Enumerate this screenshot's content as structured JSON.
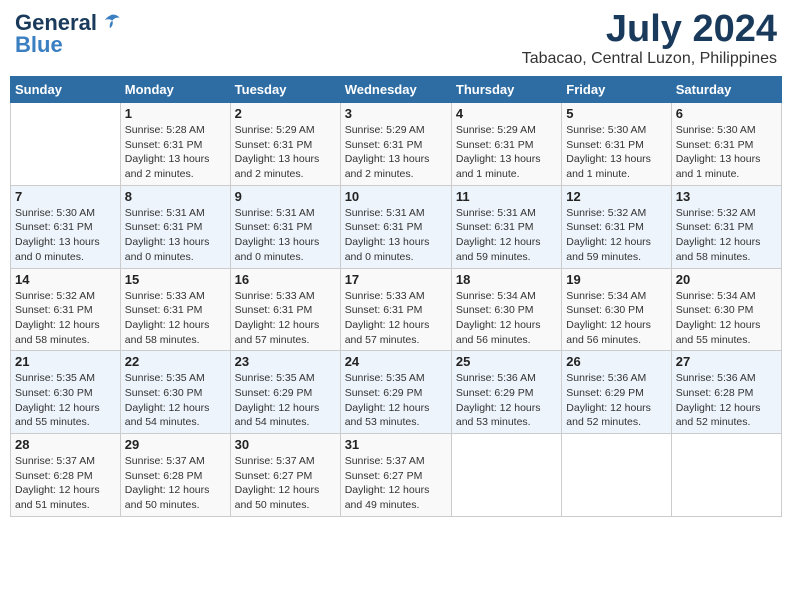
{
  "header": {
    "logo_general": "General",
    "logo_blue": "Blue",
    "main_title": "July 2024",
    "subtitle": "Tabacao, Central Luzon, Philippines"
  },
  "calendar": {
    "days_of_week": [
      "Sunday",
      "Monday",
      "Tuesday",
      "Wednesday",
      "Thursday",
      "Friday",
      "Saturday"
    ],
    "weeks": [
      [
        {
          "day": "",
          "info": ""
        },
        {
          "day": "1",
          "info": "Sunrise: 5:28 AM\nSunset: 6:31 PM\nDaylight: 13 hours\nand 2 minutes."
        },
        {
          "day": "2",
          "info": "Sunrise: 5:29 AM\nSunset: 6:31 PM\nDaylight: 13 hours\nand 2 minutes."
        },
        {
          "day": "3",
          "info": "Sunrise: 5:29 AM\nSunset: 6:31 PM\nDaylight: 13 hours\nand 2 minutes."
        },
        {
          "day": "4",
          "info": "Sunrise: 5:29 AM\nSunset: 6:31 PM\nDaylight: 13 hours\nand 1 minute."
        },
        {
          "day": "5",
          "info": "Sunrise: 5:30 AM\nSunset: 6:31 PM\nDaylight: 13 hours\nand 1 minute."
        },
        {
          "day": "6",
          "info": "Sunrise: 5:30 AM\nSunset: 6:31 PM\nDaylight: 13 hours\nand 1 minute."
        }
      ],
      [
        {
          "day": "7",
          "info": "Sunrise: 5:30 AM\nSunset: 6:31 PM\nDaylight: 13 hours\nand 0 minutes."
        },
        {
          "day": "8",
          "info": "Sunrise: 5:31 AM\nSunset: 6:31 PM\nDaylight: 13 hours\nand 0 minutes."
        },
        {
          "day": "9",
          "info": "Sunrise: 5:31 AM\nSunset: 6:31 PM\nDaylight: 13 hours\nand 0 minutes."
        },
        {
          "day": "10",
          "info": "Sunrise: 5:31 AM\nSunset: 6:31 PM\nDaylight: 13 hours\nand 0 minutes."
        },
        {
          "day": "11",
          "info": "Sunrise: 5:31 AM\nSunset: 6:31 PM\nDaylight: 12 hours\nand 59 minutes."
        },
        {
          "day": "12",
          "info": "Sunrise: 5:32 AM\nSunset: 6:31 PM\nDaylight: 12 hours\nand 59 minutes."
        },
        {
          "day": "13",
          "info": "Sunrise: 5:32 AM\nSunset: 6:31 PM\nDaylight: 12 hours\nand 58 minutes."
        }
      ],
      [
        {
          "day": "14",
          "info": "Sunrise: 5:32 AM\nSunset: 6:31 PM\nDaylight: 12 hours\nand 58 minutes."
        },
        {
          "day": "15",
          "info": "Sunrise: 5:33 AM\nSunset: 6:31 PM\nDaylight: 12 hours\nand 58 minutes."
        },
        {
          "day": "16",
          "info": "Sunrise: 5:33 AM\nSunset: 6:31 PM\nDaylight: 12 hours\nand 57 minutes."
        },
        {
          "day": "17",
          "info": "Sunrise: 5:33 AM\nSunset: 6:31 PM\nDaylight: 12 hours\nand 57 minutes."
        },
        {
          "day": "18",
          "info": "Sunrise: 5:34 AM\nSunset: 6:30 PM\nDaylight: 12 hours\nand 56 minutes."
        },
        {
          "day": "19",
          "info": "Sunrise: 5:34 AM\nSunset: 6:30 PM\nDaylight: 12 hours\nand 56 minutes."
        },
        {
          "day": "20",
          "info": "Sunrise: 5:34 AM\nSunset: 6:30 PM\nDaylight: 12 hours\nand 55 minutes."
        }
      ],
      [
        {
          "day": "21",
          "info": "Sunrise: 5:35 AM\nSunset: 6:30 PM\nDaylight: 12 hours\nand 55 minutes."
        },
        {
          "day": "22",
          "info": "Sunrise: 5:35 AM\nSunset: 6:30 PM\nDaylight: 12 hours\nand 54 minutes."
        },
        {
          "day": "23",
          "info": "Sunrise: 5:35 AM\nSunset: 6:29 PM\nDaylight: 12 hours\nand 54 minutes."
        },
        {
          "day": "24",
          "info": "Sunrise: 5:35 AM\nSunset: 6:29 PM\nDaylight: 12 hours\nand 53 minutes."
        },
        {
          "day": "25",
          "info": "Sunrise: 5:36 AM\nSunset: 6:29 PM\nDaylight: 12 hours\nand 53 minutes."
        },
        {
          "day": "26",
          "info": "Sunrise: 5:36 AM\nSunset: 6:29 PM\nDaylight: 12 hours\nand 52 minutes."
        },
        {
          "day": "27",
          "info": "Sunrise: 5:36 AM\nSunset: 6:28 PM\nDaylight: 12 hours\nand 52 minutes."
        }
      ],
      [
        {
          "day": "28",
          "info": "Sunrise: 5:37 AM\nSunset: 6:28 PM\nDaylight: 12 hours\nand 51 minutes."
        },
        {
          "day": "29",
          "info": "Sunrise: 5:37 AM\nSunset: 6:28 PM\nDaylight: 12 hours\nand 50 minutes."
        },
        {
          "day": "30",
          "info": "Sunrise: 5:37 AM\nSunset: 6:27 PM\nDaylight: 12 hours\nand 50 minutes."
        },
        {
          "day": "31",
          "info": "Sunrise: 5:37 AM\nSunset: 6:27 PM\nDaylight: 12 hours\nand 49 minutes."
        },
        {
          "day": "",
          "info": ""
        },
        {
          "day": "",
          "info": ""
        },
        {
          "day": "",
          "info": ""
        }
      ]
    ]
  }
}
